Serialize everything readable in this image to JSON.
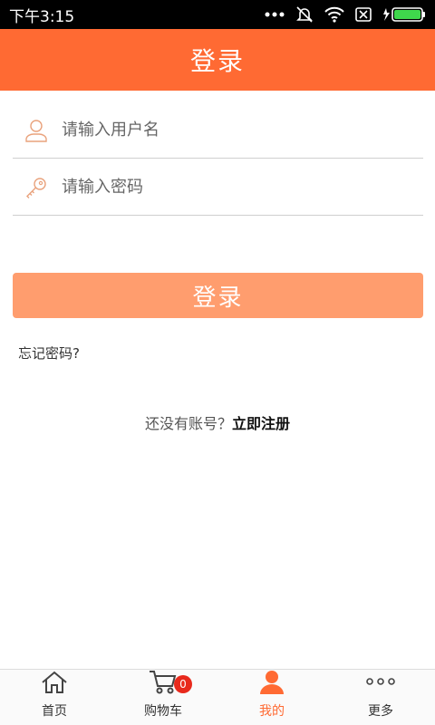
{
  "status_bar": {
    "time": "下午3:15"
  },
  "header": {
    "title": "登录"
  },
  "form": {
    "username": {
      "value": "",
      "placeholder": "请输入用户名",
      "icon": "user-icon"
    },
    "password": {
      "value": "",
      "placeholder": "请输入密码",
      "icon": "key-icon"
    },
    "login_label": "登录",
    "forgot_label": "忘记密码?",
    "no_account_text": "还没有账号？",
    "register_label": "立即注册"
  },
  "tabbar": {
    "items": [
      {
        "label": "首页",
        "icon": "home-icon"
      },
      {
        "label": "购物车",
        "icon": "cart-icon",
        "badge": "0"
      },
      {
        "label": "我的",
        "icon": "person-icon",
        "active": true
      },
      {
        "label": "更多",
        "icon": "more-icon"
      }
    ]
  },
  "colors": {
    "accent": "#ff6a33",
    "button": "#ff9d6e",
    "badge": "#e8291c"
  }
}
